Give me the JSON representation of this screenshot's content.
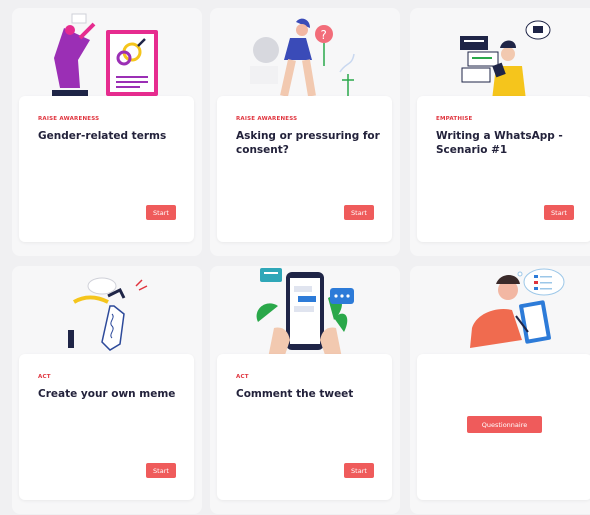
{
  "cards": [
    {
      "tag": "RAISE AWARENESS",
      "title": "Gender-related terms",
      "button": "Start"
    },
    {
      "tag": "RAISE AWARENESS",
      "title": "Asking or pressuring for consent?",
      "button": "Start"
    },
    {
      "tag": "EMPATHISE",
      "title": "Writing a WhatsApp - Scenario #1",
      "button": "Start"
    },
    {
      "tag": "ACT",
      "title": "Create your own meme",
      "button": "Start"
    },
    {
      "tag": "ACT",
      "title": "Comment the tweet",
      "button": "Start"
    },
    {
      "tag": "",
      "title": "",
      "button": "Questionnaire"
    }
  ],
  "colors": {
    "accent": "#ef5b5b",
    "tag": "#e0343e",
    "title": "#23223b",
    "purple": "#9b2fb5",
    "magenta": "#e62c8f",
    "navy": "#1f2547",
    "yellow": "#f5c51c",
    "green": "#2aa84a",
    "blue": "#2d7bd8"
  }
}
